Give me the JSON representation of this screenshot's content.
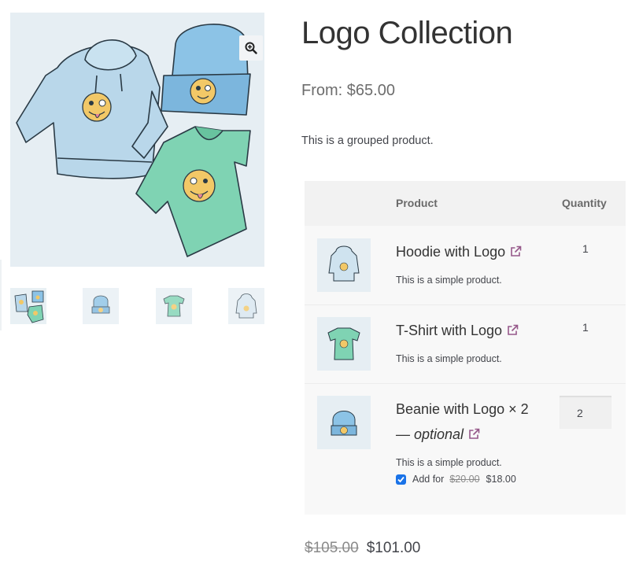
{
  "gallery": {
    "zoom_icon": "zoom-in-icon",
    "thumbnails": [
      "collection",
      "beanie",
      "t-shirt",
      "hoodie"
    ]
  },
  "product": {
    "title": "Logo Collection",
    "price_range": "From: $65.00",
    "short_description": "This is a grouped product."
  },
  "grouped_table": {
    "headers": {
      "product": "Product",
      "quantity": "Quantity"
    },
    "rows": [
      {
        "name": "Hoodie with Logo",
        "description": "This is a simple product.",
        "quantity": "1",
        "link_icon": "external-link-icon"
      },
      {
        "name": "T-Shirt with Logo",
        "description": "This is a simple product.",
        "quantity": "1",
        "link_icon": "external-link-icon"
      },
      {
        "name": "Beanie with Logo × 2",
        "optional_label": "— optional",
        "description": "This is a simple product.",
        "quantity": "2",
        "link_icon": "external-link-icon",
        "add_for": {
          "label": "Add for",
          "old_price": "$20.00",
          "new_price": "$18.00",
          "checked": true
        }
      }
    ]
  },
  "totals": {
    "old_price": "$105.00",
    "new_price": "$101.00"
  },
  "colors": {
    "link_purple": "#96588a",
    "checkbox_blue": "#1a73e8",
    "hoodie": "#b9d7ea",
    "tshirt": "#7fd3b3",
    "beanie": "#8cc3e6",
    "emoji": "#f2c867"
  }
}
